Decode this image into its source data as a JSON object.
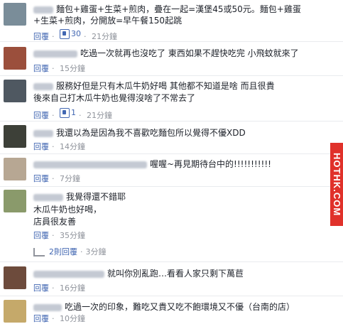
{
  "comments": [
    {
      "text_lines": [
        "麵包+雞蛋+生菜+煎肉，疊在一起=漢堡45或50元。麵包+雞蛋",
        "+生菜+煎肉，分開放=早午餐150起跳"
      ],
      "reply_label": "回覆",
      "likes": "30",
      "time": "21分鐘",
      "avatar_color": "#7a8d99"
    },
    {
      "text_lines": [
        "吃過一次就再也沒吃了 東西如果不趕快吃完 小飛蚊就來了"
      ],
      "reply_label": "回覆",
      "time": "15分鐘",
      "avatar_color": "#9b4f3c"
    },
    {
      "text_lines": [
        "服務好但是只有木瓜牛奶好喝 其他都不知道是啥 而且很貴",
        "後來自己打木瓜牛奶也覺得沒啥了不常去了"
      ],
      "reply_label": "回覆",
      "likes": "1",
      "time": "21分鐘",
      "avatar_color": "#4f5861"
    },
    {
      "text_lines": [
        "我還以為是因為我不喜歡吃麵包所以覺得不優XDD"
      ],
      "reply_label": "回覆",
      "time": "14分鐘",
      "avatar_color": "#3d4038"
    },
    {
      "text_lines": [
        "喔喔~再見期待台中的!!!!!!!!!!!"
      ],
      "reply_label": "回覆",
      "time": "7分鐘",
      "avatar_color": "#b7a793"
    },
    {
      "text_lines": [
        "我覺得還不錯耶",
        "木瓜牛奶也好喝，",
        "店員很友善"
      ],
      "reply_label": "回覆",
      "time": "35分鐘",
      "avatar_color": "#8a9a6b"
    },
    {
      "text_lines": [
        "就叫你別亂跑…看看人家只剩下萬苣"
      ],
      "reply_label": "回覆",
      "time": "16分鐘",
      "avatar_color": "#6d4b3c"
    },
    {
      "text_lines": [
        "吃過一次的印象，難吃又貴又吃不飽環境又不優（台南的店）"
      ],
      "reply_label": "回覆",
      "time": "10分鐘",
      "avatar_color": "#c5a96a"
    }
  ],
  "replies_summary": {
    "label": "2則回覆",
    "time": "3分鐘"
  },
  "watermark": "HOTHK.COM"
}
